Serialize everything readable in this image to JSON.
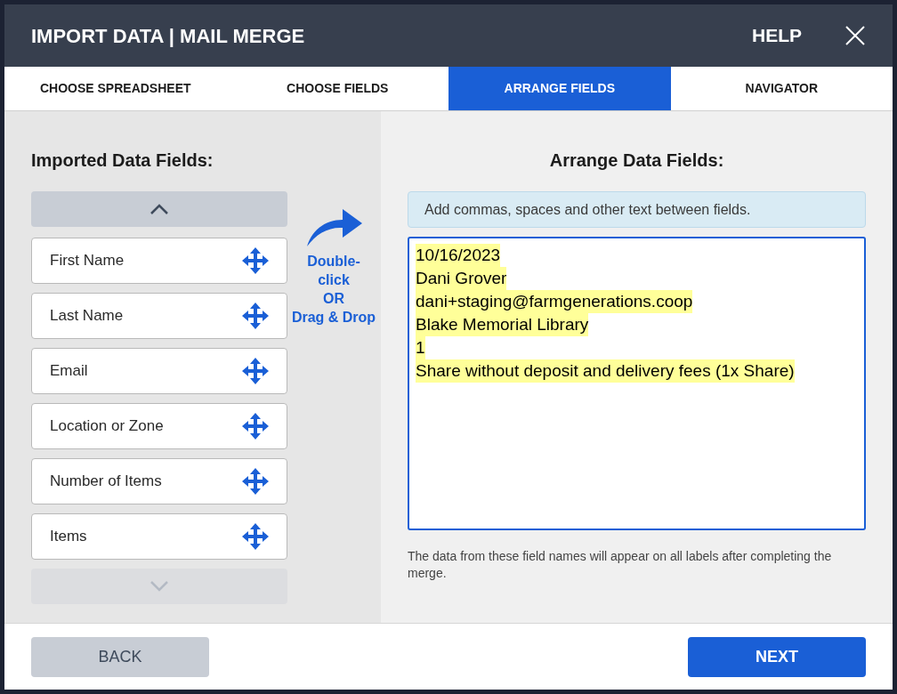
{
  "window": {
    "title": "IMPORT DATA | MAIL MERGE",
    "help": "HELP"
  },
  "tabs": [
    {
      "label": "CHOOSE SPREADSHEET",
      "selected": false
    },
    {
      "label": "CHOOSE FIELDS",
      "selected": false
    },
    {
      "label": "ARRANGE FIELDS",
      "selected": true
    },
    {
      "label": "NAVIGATOR",
      "selected": false
    }
  ],
  "imported": {
    "title": "Imported Data Fields:",
    "scroll_up": {
      "disabled": false
    },
    "scroll_down": {
      "disabled": true
    },
    "fields": [
      "First Name",
      "Last Name",
      "Email",
      "Location or Zone",
      "Number of Items",
      "Items"
    ]
  },
  "hint": {
    "lines": [
      "Double-",
      "click",
      "OR",
      "Drag & Drop"
    ]
  },
  "arrange": {
    "title": "Arrange Data Fields:",
    "info": "Add commas, spaces and other text between fields.",
    "lines": [
      "10/16/2023",
      "Dani Grover",
      "dani+staging@farmgenerations.coop",
      "Blake Memorial Library",
      "1",
      "Share without deposit and delivery fees (1x Share)"
    ],
    "note": "The data from these field names will appear on all labels after completing the merge."
  },
  "footer": {
    "back": "BACK",
    "next": "NEXT"
  }
}
